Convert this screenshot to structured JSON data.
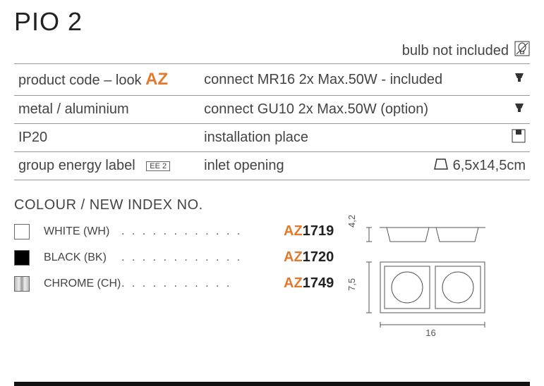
{
  "title": "PIO 2",
  "bulb_note": "bulb not included",
  "specs": {
    "row1_left_prefix": "product code – look ",
    "row1_left_az": "AZ",
    "row1_right": "connect MR16 2x Max.50W - included",
    "row2_left": "metal / aluminium",
    "row2_right": "connect GU10 2x Max.50W (option)",
    "row3_left": "IP20",
    "row3_right": "installation place",
    "row4_left": "group energy label",
    "row4_badge": "EE 2",
    "row4_right": "inlet opening",
    "row4_dim": "6,5x14,5cm"
  },
  "colour_section_title": "COLOUR / NEW INDEX NO.",
  "colours": [
    {
      "label": "WHITE (WH)",
      "prefix": "AZ",
      "num": "1719"
    },
    {
      "label": "BLACK (BK)",
      "prefix": "AZ",
      "num": "1720"
    },
    {
      "label": "CHROME (CH)",
      "prefix": "AZ",
      "num": "1749"
    }
  ],
  "diagram": {
    "h1": "4,2",
    "h2": "7,5",
    "w": "16"
  }
}
